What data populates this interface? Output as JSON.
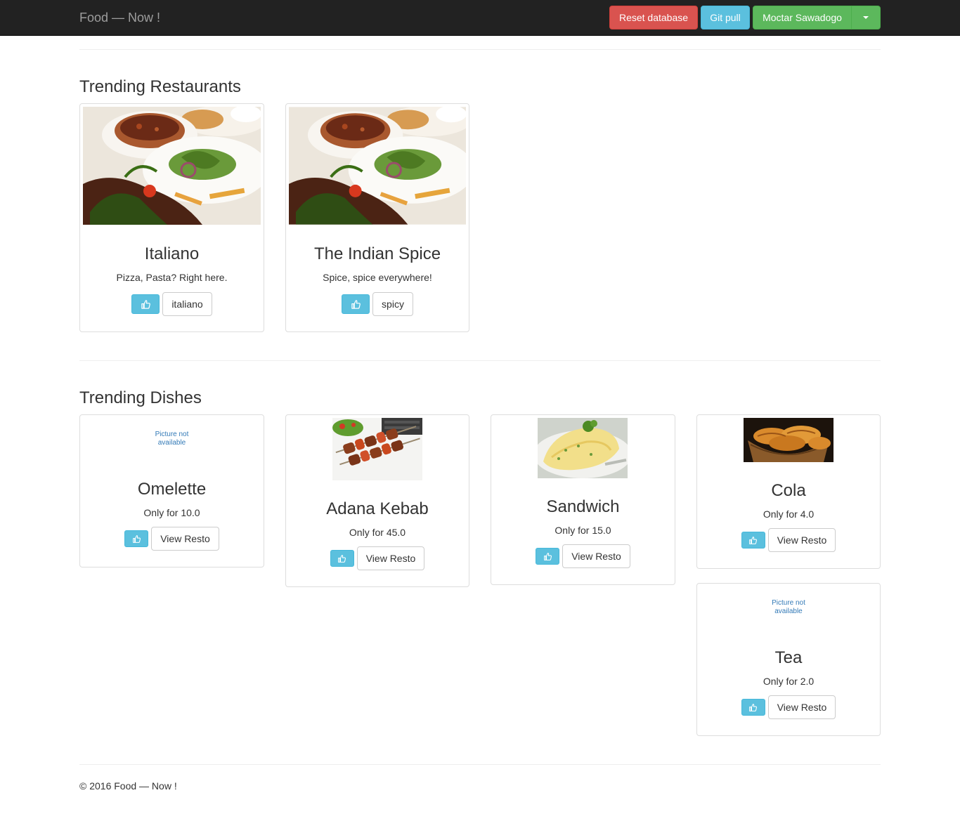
{
  "navbar": {
    "brand": "Food — Now !",
    "reset_label": "Reset database",
    "gitpull_label": "Git pull",
    "user_label": "Moctar Sawadogo"
  },
  "sections": {
    "restaurants_title": "Trending Restaurants",
    "dishes_title": "Trending Dishes"
  },
  "restaurants": [
    {
      "name": "Italiano",
      "tagline": "Pizza, Pasta? Right here.",
      "tag": "italiano"
    },
    {
      "name": "The Indian Spice",
      "tagline": "Spice, spice everywhere!",
      "tag": "spicy"
    }
  ],
  "dishes": [
    {
      "name": "Omelette",
      "price": "Only for 10.0",
      "picture_na": "Picture not available",
      "action": "View Resto"
    },
    {
      "name": "Adana Kebab",
      "price": "Only for 45.0",
      "action": "View Resto"
    },
    {
      "name": "Sandwich",
      "price": "Only for 15.0",
      "action": "View Resto"
    },
    {
      "name": "Cola",
      "price": "Only for 4.0",
      "action": "View Resto"
    },
    {
      "name": "Tea",
      "price": "Only for 2.0",
      "picture_na": "Picture not available",
      "action": "View Resto"
    }
  ],
  "footer": {
    "text": "© 2016 Food — Now !"
  },
  "colors": {
    "navbar": "#222222",
    "danger": "#d9534f",
    "info": "#5bc0de",
    "success": "#5cb85c"
  }
}
